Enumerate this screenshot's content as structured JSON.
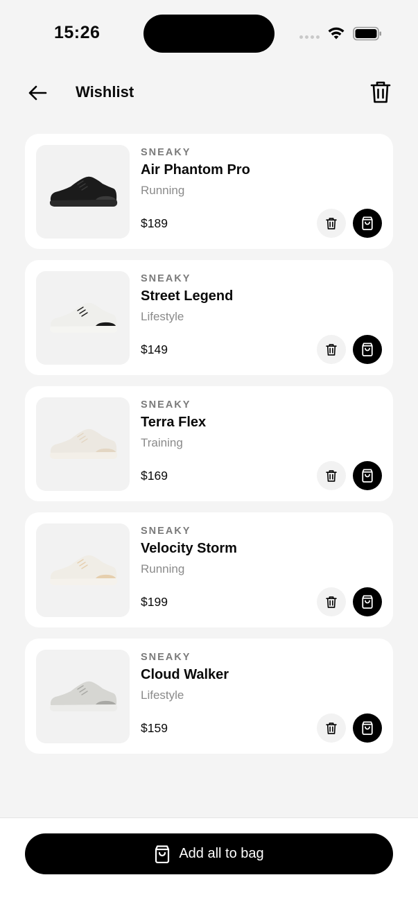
{
  "status_bar": {
    "time": "15:26"
  },
  "header": {
    "title": "Wishlist"
  },
  "items": [
    {
      "brand": "SNEAKY",
      "name": "Air Phantom Pro",
      "category": "Running",
      "price": "$189",
      "shoe_color": "#1b1b1b",
      "sole_color": "#2a2a2a",
      "accent": "#3a3a3a"
    },
    {
      "brand": "SNEAKY",
      "name": "Street Legend",
      "category": "Lifestyle",
      "price": "$149",
      "shoe_color": "#efefec",
      "sole_color": "#f5f5f2",
      "accent": "#1a1a1a"
    },
    {
      "brand": "SNEAKY",
      "name": "Terra Flex",
      "category": "Training",
      "price": "$169",
      "shoe_color": "#ece8e1",
      "sole_color": "#f3efe8",
      "accent": "#e3d6c3"
    },
    {
      "brand": "SNEAKY",
      "name": "Velocity Storm",
      "category": "Running",
      "price": "$199",
      "shoe_color": "#f0ede6",
      "sole_color": "#f5f2ec",
      "accent": "#e6cfae"
    },
    {
      "brand": "SNEAKY",
      "name": "Cloud Walker",
      "category": "Lifestyle",
      "price": "$159",
      "shoe_color": "#d6d6d2",
      "sole_color": "#ececea",
      "accent": "#a8a8a4"
    }
  ],
  "footer": {
    "add_all_label": "Add all to bag"
  }
}
